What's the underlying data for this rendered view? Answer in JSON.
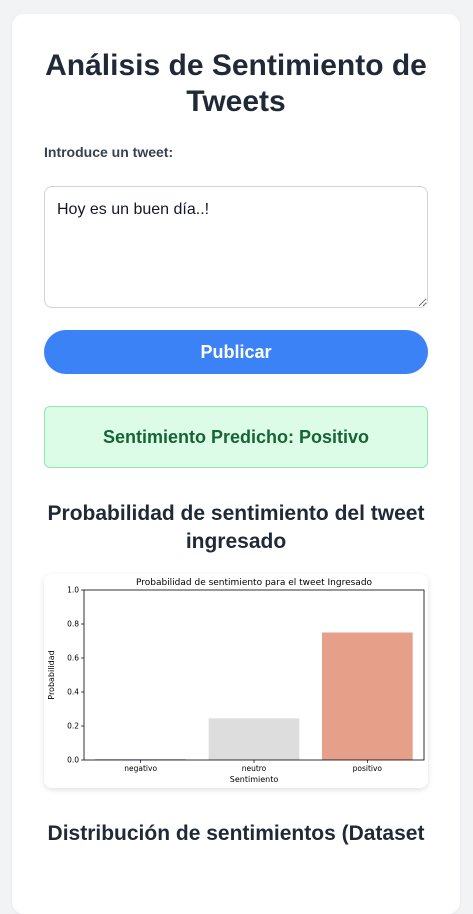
{
  "page": {
    "title": "Análisis de Sentimiento de Tweets"
  },
  "form": {
    "label": "Introduce un tweet:",
    "tweet_value": "Hoy es un buen día..!",
    "publish_label": "Publicar"
  },
  "result": {
    "prefix": "Sentimiento Predicho:",
    "value": "Positivo"
  },
  "sections": {
    "probability_title": "Probabilidad de sentimiento del tweet ingresado",
    "distribution_title": "Distribución de sentimientos (Dataset"
  },
  "colors": {
    "accent": "#3b82f6",
    "success_bg": "#dcfce7",
    "success_text": "#166534"
  },
  "chart_data": {
    "type": "bar",
    "title": "Probabilidad de sentimiento para el tweet Ingresado",
    "xlabel": "Sentimiento",
    "ylabel": "Probabilidad",
    "ylim": [
      0,
      1.0
    ],
    "yticks": [
      "0.0",
      "0.2",
      "0.4",
      "0.6",
      "0.8",
      "1.0"
    ],
    "categories": [
      "negativo",
      "neutro",
      "positivo"
    ],
    "values": [
      0.003,
      0.245,
      0.75
    ],
    "bar_colors": [
      "#5b6bc0",
      "#dddddd",
      "#e6a08a"
    ],
    "grid": false
  }
}
